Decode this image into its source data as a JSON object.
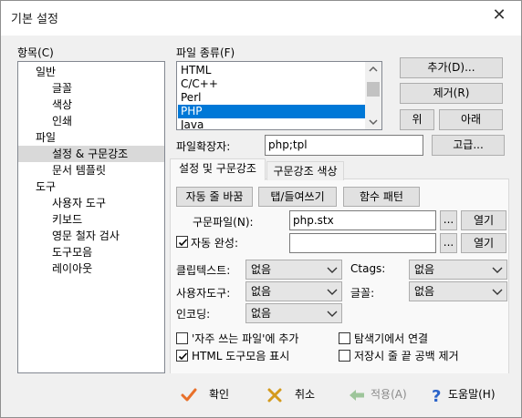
{
  "window": {
    "title": "기본 설정",
    "close_glyph": "✕"
  },
  "category": {
    "label": "항목(C)",
    "items": [
      "일반",
      "글꼴",
      "색상",
      "인쇄",
      "파일",
      "설정 & 구문강조",
      "문서 템플릿",
      "도구",
      "사용자 도구",
      "키보드",
      "영문 철자 검사",
      "도구모음",
      "레이아웃"
    ],
    "selected": "설정 & 구문강조"
  },
  "filetype": {
    "label": "파일 종류(F)",
    "items": [
      "HTML",
      "C/C++",
      "Perl",
      "PHP",
      "Java"
    ],
    "selected": "PHP",
    "scroll_up_icon": "chevron-up-icon",
    "scroll_down_icon": "chevron-down-icon"
  },
  "buttons": {
    "add": "추가(D)...",
    "remove": "제거(R)",
    "up": "위",
    "down": "아래",
    "advanced": "고급..."
  },
  "extension": {
    "label": "파일확장자:",
    "value": "php;tpl"
  },
  "tabs": {
    "settings": "설정 및 구문강조",
    "syntax_colors": "구문강조 색상",
    "active": "설정 및 구문강조"
  },
  "panel": {
    "sub_buttons": [
      "자동 줄 바꿈",
      "탭/들여쓰기",
      "함수 패턴"
    ],
    "syntax_file": {
      "label": "구문파일(N):",
      "value": "php.stx",
      "browse": "...",
      "open": "열기"
    },
    "autocomplete": {
      "label": "자동 완성:",
      "checked": true,
      "value": "",
      "browse": "...",
      "open": "열기"
    },
    "clip_text": {
      "label": "클립텍스트:",
      "value": "없음"
    },
    "ctags": {
      "label": "Ctags:",
      "value": "없음"
    },
    "user_tool": {
      "label": "사용자도구:",
      "value": "없음"
    },
    "font": {
      "label": "글꼴:",
      "value": "없음"
    },
    "encoding": {
      "label": "인코딩:",
      "value": "없음"
    },
    "options": [
      {
        "label": "'자주 쓰는 파일'에 추가",
        "checked": false
      },
      {
        "label": "탐색기에서 연결",
        "checked": false
      },
      {
        "label": "HTML 도구모음 표시",
        "checked": true
      },
      {
        "label": "저장시 줄 끝 공백 제거",
        "checked": false
      }
    ]
  },
  "footer": {
    "ok": "확인",
    "cancel": "취소",
    "apply": "적용(A)",
    "help": "도움말(H)",
    "colors": {
      "ok_icon": "#e8702a",
      "cancel_icon": "#d49a1c",
      "apply_icon": "#9dc59a",
      "help_icon": "#2b63c9",
      "disabled_text": "#8a8a8a"
    }
  }
}
